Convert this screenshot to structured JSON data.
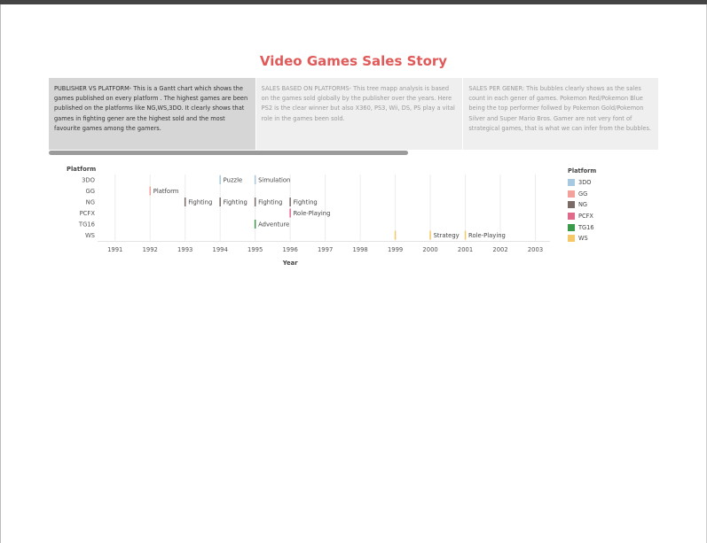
{
  "story": {
    "title": "Video Games Sales Story",
    "points": [
      {
        "text": "PUBLISHER VS PLATFORM- This is a Gantt chart which shows the  games published on every platform . The highest games are been published on the platforms like  NG,WS,3DO. It clearly shows that games in fighting gener are the highest sold and the most favourite games among the gamers.",
        "active": true
      },
      {
        "text": "SALES BASED ON PLATFORMS- This tree mapp analysis is based on the games sold globally by the publisher over the years. Here PS2 is the clear winner but also X360, PS3, Wii, DS, PS play a vital role in the games been sold.",
        "active": false
      },
      {
        "text": "SALES PER GENER: This bubbles clearly shows as the sales count in each gener of games.  Pokemon Red/Pokemon Blue being the top performer follwed by Pokemon Gold/Pokemon Silver and Super Mario Bros.  Gamer are not very font of strategical games, that is what we can infer from the bubbles.",
        "active": false
      }
    ]
  },
  "chart_data": {
    "type": "gantt",
    "ylabel": "Platform",
    "xlabel": "Year",
    "x_ticks": [
      1991,
      1992,
      1993,
      1994,
      1995,
      1996,
      1997,
      1998,
      1999,
      2000,
      2001,
      2002,
      2003
    ],
    "xlim": [
      1990.5,
      2003.3
    ],
    "platforms": [
      "3DO",
      "GG",
      "NG",
      "PCFX",
      "TG16",
      "WS"
    ],
    "colors": {
      "3DO": "#a6c8e0",
      "GG": "#f2a19b",
      "NG": "#7a6b66",
      "PCFX": "#df6a8a",
      "TG16": "#3a9a4a",
      "WS": "#f5c86a"
    },
    "marks": [
      {
        "platform": "3DO",
        "year": 1994,
        "label": "Puzzle"
      },
      {
        "platform": "3DO",
        "year": 1995,
        "label": "Simulation"
      },
      {
        "platform": "GG",
        "year": 1992,
        "label": "Platform"
      },
      {
        "platform": "NG",
        "year": 1993,
        "label": "Fighting"
      },
      {
        "platform": "NG",
        "year": 1994,
        "label": "Fighting"
      },
      {
        "platform": "NG",
        "year": 1995,
        "label": "Fighting"
      },
      {
        "platform": "NG",
        "year": 1996,
        "label": "Fighting"
      },
      {
        "platform": "PCFX",
        "year": 1996,
        "label": "Role-Playing"
      },
      {
        "platform": "TG16",
        "year": 1995,
        "label": "Adventure"
      },
      {
        "platform": "WS",
        "year": 1999,
        "label": ""
      },
      {
        "platform": "WS",
        "year": 2000,
        "label": "Strategy"
      },
      {
        "platform": "WS",
        "year": 2001,
        "label": "Role-Playing"
      }
    ],
    "grid": true,
    "legend": {
      "title": "Platform",
      "placement": "right"
    }
  }
}
